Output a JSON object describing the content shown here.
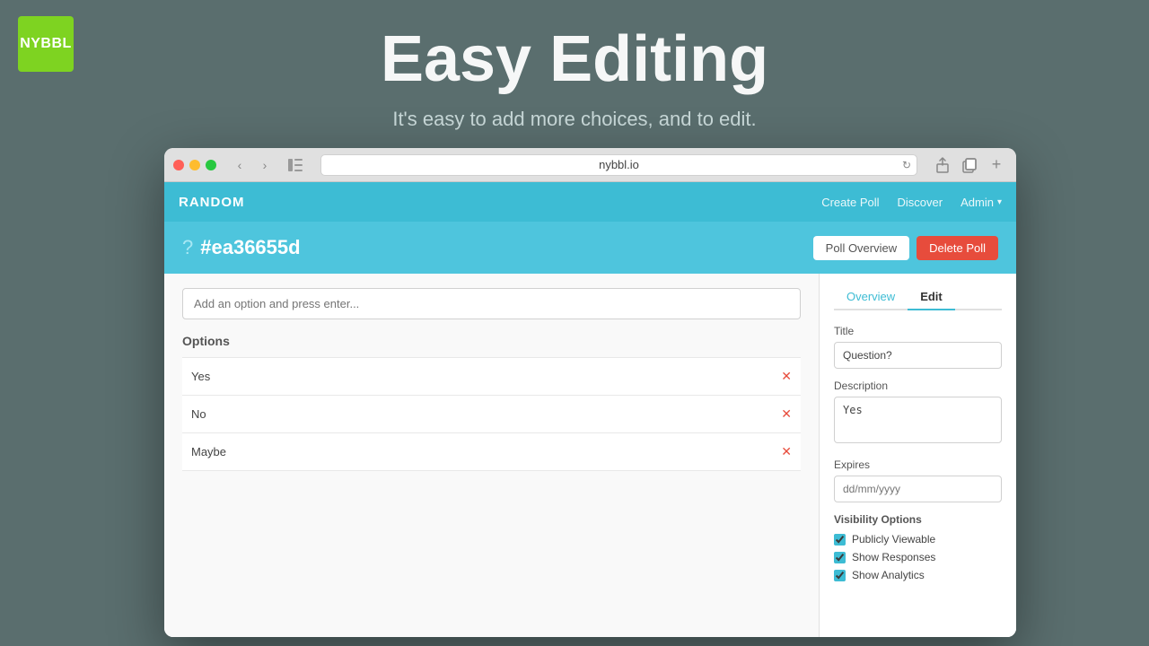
{
  "logo": {
    "text": "NYBBL"
  },
  "hero": {
    "title": "Easy Editing",
    "subtitle": "It's easy to add more choices, and to edit."
  },
  "browser": {
    "url": "nybbl.io"
  },
  "nav": {
    "brand": "RANDOM",
    "links": [
      "Create Poll",
      "Discover",
      "Admin"
    ],
    "admin_chevron": "▾"
  },
  "poll_header": {
    "icon": "?",
    "id": "#ea36655d",
    "btn_overview": "Poll Overview",
    "btn_delete": "Delete Poll"
  },
  "left_panel": {
    "add_placeholder": "Add an option and press enter...",
    "options_label": "Options",
    "options": [
      {
        "text": "Yes"
      },
      {
        "text": "No"
      },
      {
        "text": "Maybe"
      }
    ]
  },
  "right_panel": {
    "tabs": [
      {
        "label": "Overview",
        "active": false
      },
      {
        "label": "Edit",
        "active": true
      }
    ],
    "fields": {
      "title_label": "Title",
      "title_value": "Question?",
      "description_label": "Description",
      "description_value": "Yes",
      "expires_label": "Expires",
      "expires_placeholder": "dd/mm/yyyy",
      "visibility_label": "Visibility Options",
      "checkboxes": [
        {
          "label": "Publicly Viewable",
          "checked": true
        },
        {
          "label": "Show Responses",
          "checked": true
        },
        {
          "label": "Show Analytics",
          "checked": true
        }
      ]
    }
  }
}
